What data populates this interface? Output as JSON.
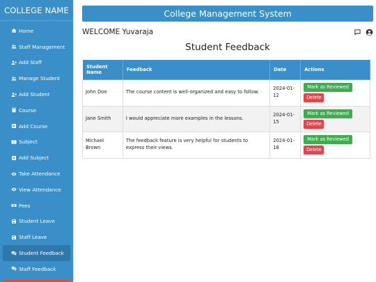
{
  "sidebar": {
    "brand": "COLLEGE NAME",
    "items": [
      {
        "label": "Home",
        "icon": "home-icon",
        "active": false
      },
      {
        "label": "Staff Management",
        "icon": "users-icon",
        "active": false
      },
      {
        "label": "Add Staff",
        "icon": "user-plus-icon",
        "active": false
      },
      {
        "label": "Manage Student",
        "icon": "users-icon",
        "active": false
      },
      {
        "label": "Add Student",
        "icon": "user-plus-icon",
        "active": false
      },
      {
        "label": "Course",
        "icon": "book-icon",
        "active": false
      },
      {
        "label": "Add Course",
        "icon": "plus-square-icon",
        "active": false
      },
      {
        "label": "Subject",
        "icon": "book-open-icon",
        "active": false
      },
      {
        "label": "Add Subject",
        "icon": "plus-square-icon",
        "active": false
      },
      {
        "label": "Take Attendance",
        "icon": "eye-icon",
        "active": false
      },
      {
        "label": "View Attendance",
        "icon": "eye-icon",
        "active": false
      },
      {
        "label": "Fees",
        "icon": "money-icon",
        "active": false
      },
      {
        "label": "Student Leave",
        "icon": "save-icon",
        "active": false
      },
      {
        "label": "Staff Leave",
        "icon": "save-icon",
        "active": false
      },
      {
        "label": "Student Feedback",
        "icon": "comments-icon",
        "active": true
      },
      {
        "label": "Staff Feedback",
        "icon": "comments-icon",
        "active": false
      }
    ]
  },
  "header": {
    "title": "College Management System",
    "welcome": "WELCOME Yuvaraja"
  },
  "page": {
    "title": "Student Feedback"
  },
  "table": {
    "headers": [
      "Student Name",
      "Feedback",
      "Date",
      "Actions"
    ],
    "rows": [
      {
        "name": "John Doe",
        "feedback": "The course content is well-organized and easy to follow.",
        "date": "2024-01-12"
      },
      {
        "name": "Jane Smith",
        "feedback": "I would appreciate more examples in the lessons.",
        "date": "2024-01-15"
      },
      {
        "name": "Michael Brown",
        "feedback": "The feedback feature is very helpful for students to express their views.",
        "date": "2024-01-18"
      }
    ],
    "actions": {
      "review": "Mark as Reviewed",
      "delete": "Delete"
    }
  },
  "colors": {
    "primary": "#3a8fc8",
    "active_nav": "#2f78ab",
    "success": "#3cae50",
    "danger": "#e0464b"
  }
}
